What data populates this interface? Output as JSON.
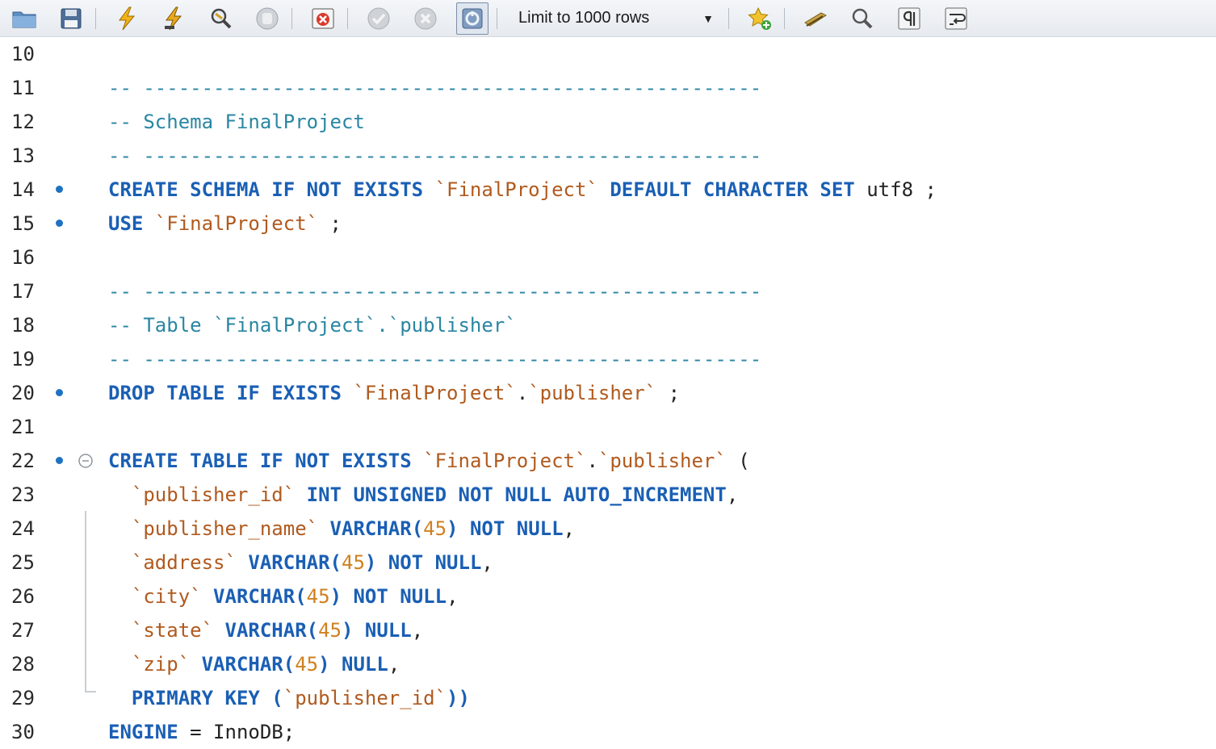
{
  "toolbar": {
    "limit_label": "Limit to 1000 rows",
    "icons": [
      "open-file-icon",
      "save-icon",
      "execute-icon",
      "execute-current-icon",
      "explain-icon",
      "stop-icon",
      "toggle-error-icon",
      "commit-icon",
      "rollback-icon",
      "autocommit-icon",
      "add-snippet-icon",
      "beautify-icon",
      "find-icon",
      "invisible-chars-icon",
      "word-wrap-icon"
    ]
  },
  "editor": {
    "lines": [
      {
        "n": "10",
        "dot": false,
        "segs": []
      },
      {
        "n": "11",
        "dot": false,
        "segs": [
          {
            "c": "cm",
            "t": "-- -----------------------------------------------------"
          }
        ]
      },
      {
        "n": "12",
        "dot": false,
        "segs": [
          {
            "c": "cm",
            "t": "-- Schema FinalProject"
          }
        ]
      },
      {
        "n": "13",
        "dot": false,
        "segs": [
          {
            "c": "cm",
            "t": "-- -----------------------------------------------------"
          }
        ]
      },
      {
        "n": "14",
        "dot": true,
        "segs": [
          {
            "c": "kw",
            "t": "CREATE SCHEMA IF NOT EXISTS "
          },
          {
            "c": "id",
            "t": "`FinalProject`"
          },
          {
            "c": "kw",
            "t": " DEFAULT CHARACTER SET "
          },
          {
            "c": "pl",
            "t": "utf8 ;"
          }
        ]
      },
      {
        "n": "15",
        "dot": true,
        "segs": [
          {
            "c": "kw",
            "t": "USE "
          },
          {
            "c": "id",
            "t": "`FinalProject`"
          },
          {
            "c": "pl",
            "t": " ;"
          }
        ]
      },
      {
        "n": "16",
        "dot": false,
        "segs": []
      },
      {
        "n": "17",
        "dot": false,
        "segs": [
          {
            "c": "cm",
            "t": "-- -----------------------------------------------------"
          }
        ]
      },
      {
        "n": "18",
        "dot": false,
        "segs": [
          {
            "c": "cm",
            "t": "-- Table `FinalProject`.`publisher`"
          }
        ]
      },
      {
        "n": "19",
        "dot": false,
        "segs": [
          {
            "c": "cm",
            "t": "-- -----------------------------------------------------"
          }
        ]
      },
      {
        "n": "20",
        "dot": true,
        "segs": [
          {
            "c": "kw",
            "t": "DROP TABLE IF EXISTS "
          },
          {
            "c": "id",
            "t": "`FinalProject`"
          },
          {
            "c": "pl",
            "t": "."
          },
          {
            "c": "id",
            "t": "`publisher`"
          },
          {
            "c": "pl",
            "t": " ;"
          }
        ]
      },
      {
        "n": "21",
        "dot": false,
        "segs": []
      },
      {
        "n": "22",
        "dot": true,
        "fold": true,
        "segs": [
          {
            "c": "kw",
            "t": "CREATE TABLE IF NOT EXISTS "
          },
          {
            "c": "id",
            "t": "`FinalProject`"
          },
          {
            "c": "pl",
            "t": "."
          },
          {
            "c": "id",
            "t": "`publisher`"
          },
          {
            "c": "pl",
            "t": " ("
          }
        ]
      },
      {
        "n": "23",
        "dot": false,
        "segs": [
          {
            "c": "pl",
            "t": "  "
          },
          {
            "c": "id",
            "t": "`publisher_id`"
          },
          {
            "c": "kw",
            "t": " INT UNSIGNED NOT NULL AUTO_INCREMENT"
          },
          {
            "c": "pl",
            "t": ","
          }
        ]
      },
      {
        "n": "24",
        "dot": false,
        "segs": [
          {
            "c": "pl",
            "t": "  "
          },
          {
            "c": "id",
            "t": "`publisher_name`"
          },
          {
            "c": "kw",
            "t": " VARCHAR("
          },
          {
            "c": "num",
            "t": "45"
          },
          {
            "c": "kw",
            "t": ") NOT NULL"
          },
          {
            "c": "pl",
            "t": ","
          }
        ]
      },
      {
        "n": "25",
        "dot": false,
        "segs": [
          {
            "c": "pl",
            "t": "  "
          },
          {
            "c": "id",
            "t": "`address`"
          },
          {
            "c": "kw",
            "t": " VARCHAR("
          },
          {
            "c": "num",
            "t": "45"
          },
          {
            "c": "kw",
            "t": ") NOT NULL"
          },
          {
            "c": "pl",
            "t": ","
          }
        ]
      },
      {
        "n": "26",
        "dot": false,
        "segs": [
          {
            "c": "pl",
            "t": "  "
          },
          {
            "c": "id",
            "t": "`city`"
          },
          {
            "c": "kw",
            "t": " VARCHAR("
          },
          {
            "c": "num",
            "t": "45"
          },
          {
            "c": "kw",
            "t": ") NOT NULL"
          },
          {
            "c": "pl",
            "t": ","
          }
        ]
      },
      {
        "n": "27",
        "dot": false,
        "segs": [
          {
            "c": "pl",
            "t": "  "
          },
          {
            "c": "id",
            "t": "`state`"
          },
          {
            "c": "kw",
            "t": " VARCHAR("
          },
          {
            "c": "num",
            "t": "45"
          },
          {
            "c": "kw",
            "t": ") NULL"
          },
          {
            "c": "pl",
            "t": ","
          }
        ]
      },
      {
        "n": "28",
        "dot": false,
        "segs": [
          {
            "c": "pl",
            "t": "  "
          },
          {
            "c": "id",
            "t": "`zip`"
          },
          {
            "c": "kw",
            "t": " VARCHAR("
          },
          {
            "c": "num",
            "t": "45"
          },
          {
            "c": "kw",
            "t": ") NULL"
          },
          {
            "c": "pl",
            "t": ","
          }
        ]
      },
      {
        "n": "29",
        "dot": false,
        "segs": [
          {
            "c": "pl",
            "t": "  "
          },
          {
            "c": "kw",
            "t": "PRIMARY KEY ("
          },
          {
            "c": "id",
            "t": "`publisher_id`"
          },
          {
            "c": "kw",
            "t": "))"
          }
        ]
      },
      {
        "n": "30",
        "dot": false,
        "segs": [
          {
            "c": "kw",
            "t": "ENGINE "
          },
          {
            "c": "pl",
            "t": "= InnoDB;"
          }
        ]
      }
    ]
  }
}
